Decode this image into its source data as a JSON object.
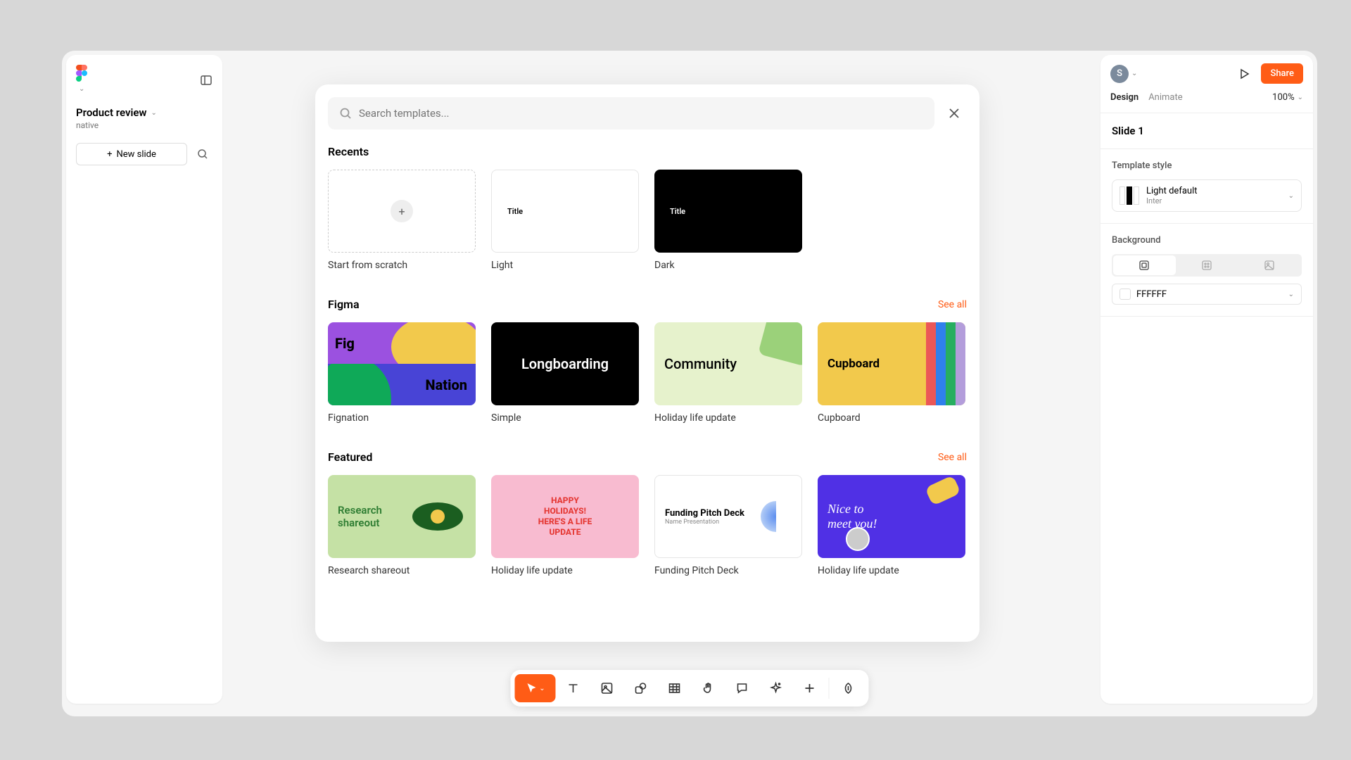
{
  "left_panel": {
    "title": "Product review",
    "subtitle": "native",
    "new_slide_label": "New slide"
  },
  "right_panel": {
    "avatar_initial": "S",
    "share_label": "Share",
    "tabs": {
      "design": "Design",
      "animate": "Animate"
    },
    "zoom": "100%",
    "slide_title": "Slide 1",
    "template_section_label": "Template style",
    "template_style": {
      "name": "Light default",
      "font": "Inter"
    },
    "background_section_label": "Background",
    "background_color": "FFFFFF"
  },
  "modal": {
    "search_placeholder": "Search templates...",
    "sections": {
      "recents": {
        "title": "Recents",
        "items": [
          "Start from scratch",
          "Light",
          "Dark"
        ]
      },
      "figma": {
        "title": "Figma",
        "see_all": "See all",
        "items": [
          "Fignation",
          "Simple",
          "Holiday life update",
          "Cupboard"
        ]
      },
      "featured": {
        "title": "Featured",
        "see_all": "See all",
        "items": [
          "Research shareout",
          "Holiday life update",
          "Funding Pitch Deck",
          "Holiday life update"
        ]
      }
    },
    "thumb_text": {
      "title_small": "Title",
      "longboarding": "Longboarding",
      "community": "Community",
      "cupboard": "Cupboard",
      "fig": "Fig",
      "nation": "Nation",
      "research": "Research\nshareout",
      "holiday": "HAPPY\nHOLIDAYS!\nHERE'S A LIFE\nUPDATE",
      "funding_title": "Funding Pitch Deck",
      "funding_sub": "Name Presentation",
      "nice": "Nice to\nmeet you!"
    }
  }
}
